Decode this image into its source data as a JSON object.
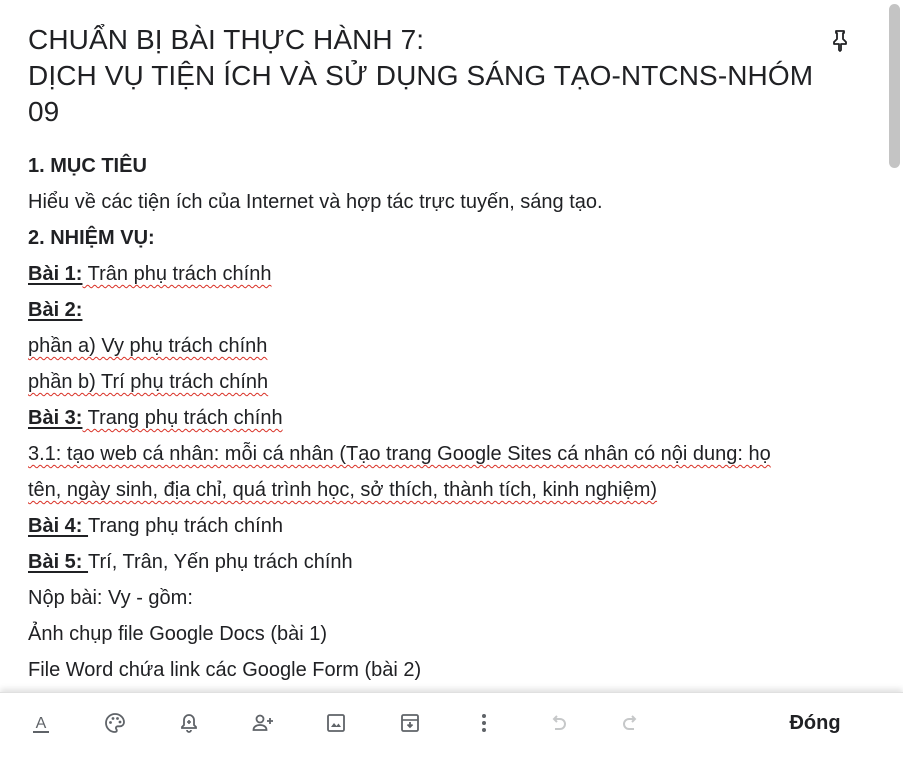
{
  "note": {
    "title_lines": [
      "CHUẨN BỊ BÀI THỰC HÀNH 7:",
      "DỊCH VỤ TIỆN ÍCH VÀ SỬ DỤNG SÁNG TẠO-NTCNS-NHÓM",
      "09"
    ],
    "body": {
      "heading1": "1. MỤC TIÊU",
      "goal": "Hiểu về các tiện ích của Internet và hợp tác trực tuyến, sáng tạo.",
      "heading2": "2. NHIỆM VỤ:",
      "bai1_label": "Bài 1:",
      "bai1_text": " Trân phụ trách chính",
      "bai2_label": "Bài 2: ",
      "part_a": "phần a) Vy phụ trách chính",
      "part_b": "phần b) Trí phụ trách chính",
      "bai3_label": "Bài 3:",
      "bai3_text": " Trang phụ trách chính",
      "task31_line1": "3.1: tạo web cá nhân: mỗi cá nhân (Tạo trang Google Sites cá nhân có nội dung: họ",
      "task31_line2": "tên, ngày sinh, địa chỉ, quá trình học, sở thích, thành tích, kinh nghiệm)",
      "bai4_label": "Bài 4: ",
      "bai4_text": "Trang phụ trách chính",
      "bai5_label": "Bài 5: ",
      "bai5_text": "Trí, Trân, Yến phụ trách chính",
      "submit": "Nộp bài: Vy - gồm:",
      "submit_item1": "Ảnh chụp file Google Docs (bài 1)",
      "submit_item2": "File Word chứa link các Google Form (bài 2)"
    }
  },
  "toolbar": {
    "icons": [
      "format-text-icon",
      "palette-icon",
      "reminder-bell-icon",
      "collaborator-icon",
      "image-icon",
      "archive-icon",
      "more-vert-icon",
      "undo-icon",
      "redo-icon"
    ],
    "close_label": "Đóng"
  },
  "colors": {
    "text": "#202124",
    "icon": "#5f6368",
    "spellcheck": "#d93025",
    "scroll_thumb": "#c4c4c4"
  }
}
